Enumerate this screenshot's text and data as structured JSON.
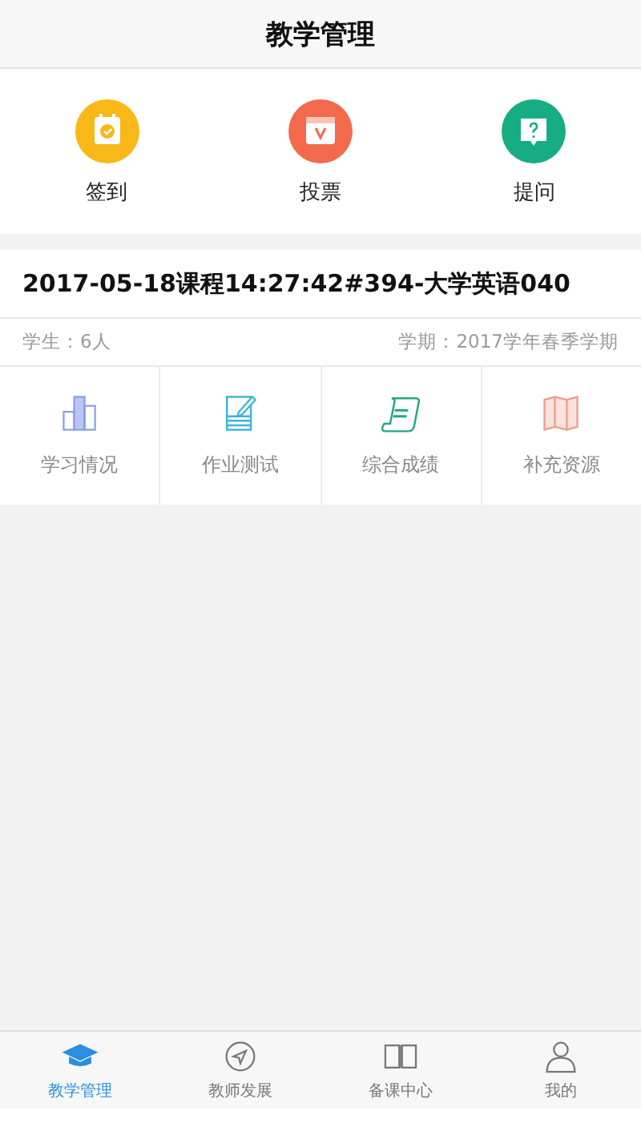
{
  "header": {
    "title": "教学管理"
  },
  "quick_actions": [
    {
      "label": "签到",
      "kind": "checkin",
      "color": "#f8b817"
    },
    {
      "label": "投票",
      "kind": "vote",
      "color": "#f26a4b"
    },
    {
      "label": "提问",
      "kind": "question",
      "color": "#17ad83"
    }
  ],
  "course": {
    "title": "2017-05-18课程14:27:42#394-大学英语040",
    "students": "学生：6人",
    "term": "学期：2017学年春季学期",
    "tools": [
      {
        "label": "学习情况",
        "kind": "chart"
      },
      {
        "label": "作业测试",
        "kind": "edit"
      },
      {
        "label": "综合成绩",
        "kind": "scroll"
      },
      {
        "label": "补充资源",
        "kind": "map"
      }
    ]
  },
  "tab_bar": [
    {
      "label": "教学管理",
      "kind": "cap",
      "selected": true
    },
    {
      "label": "教师发展",
      "kind": "compass",
      "selected": false
    },
    {
      "label": "备课中心",
      "kind": "book",
      "selected": false
    },
    {
      "label": "我的",
      "kind": "user",
      "selected": false
    }
  ]
}
